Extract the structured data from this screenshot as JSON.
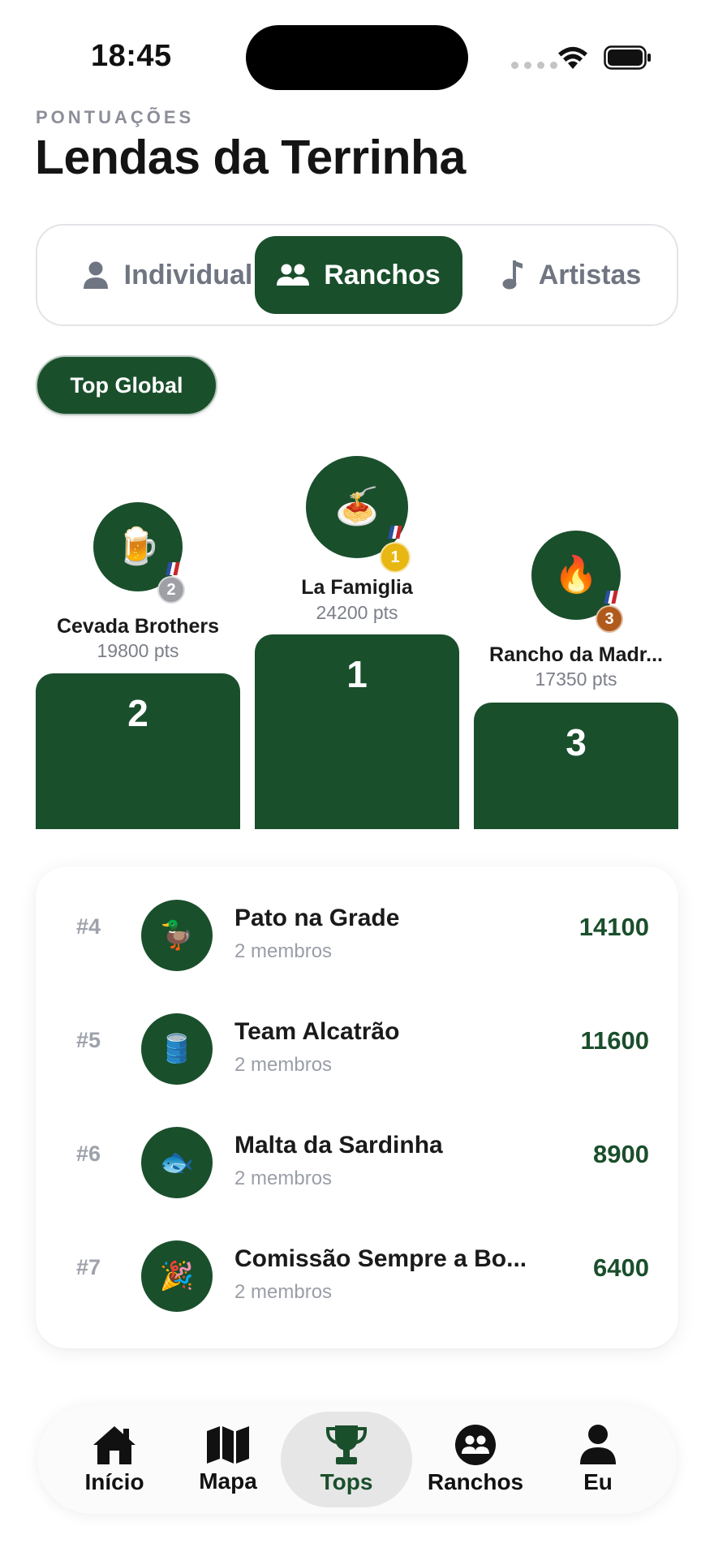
{
  "status_bar": {
    "time": "18:45"
  },
  "header": {
    "kicker": "PONTUAÇÕES",
    "title": "Lendas da Terrinha"
  },
  "segments": [
    {
      "label": "Individual",
      "icon": "person-icon",
      "active": false
    },
    {
      "label": "Ranchos",
      "icon": "group-icon",
      "active": true
    },
    {
      "label": "Artistas",
      "icon": "music-note-icon",
      "active": false
    }
  ],
  "filter_chip": {
    "label": "Top Global"
  },
  "podium": [
    {
      "position": "2",
      "name": "Cevada Brothers",
      "points": "19800 pts",
      "emoji": "🍺",
      "medal": "2",
      "medal_color": "#9ea0a6"
    },
    {
      "position": "1",
      "name": "La Famiglia",
      "points": "24200 pts",
      "emoji": "🍝",
      "medal": "1",
      "medal_color": "#e8b712"
    },
    {
      "position": "3",
      "name": "Rancho da Madr...",
      "points": "17350 pts",
      "emoji": "🔥",
      "medal": "3",
      "medal_color": "#b05a1c"
    }
  ],
  "ranking": [
    {
      "rank": "#4",
      "name": "Pato na Grade",
      "members": "2 membros",
      "score": "14100",
      "emoji": "🦆"
    },
    {
      "rank": "#5",
      "name": "Team Alcatrão",
      "members": "2 membros",
      "score": "11600",
      "emoji": "🛢️"
    },
    {
      "rank": "#6",
      "name": "Malta da Sardinha",
      "members": "2 membros",
      "score": "8900",
      "emoji": "🐟"
    },
    {
      "rank": "#7",
      "name": "Comissão Sempre a Bo...",
      "members": "2 membros",
      "score": "6400",
      "emoji": "🎉"
    }
  ],
  "tabbar": [
    {
      "label": "Início",
      "icon": "home-icon",
      "active": false
    },
    {
      "label": "Mapa",
      "icon": "map-icon",
      "active": false
    },
    {
      "label": "Tops",
      "icon": "trophy-icon",
      "active": true
    },
    {
      "label": "Ranchos",
      "icon": "group-icon",
      "active": false
    },
    {
      "label": "Eu",
      "icon": "person-icon",
      "active": false
    }
  ],
  "colors": {
    "brand_green": "#1a4f2c",
    "muted_text": "#8c8f99",
    "gold": "#e8b712",
    "silver": "#9ea0a6",
    "bronze": "#b05a1c"
  }
}
